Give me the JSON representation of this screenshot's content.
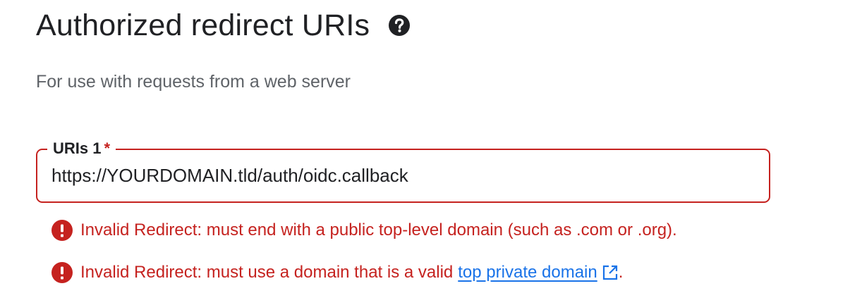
{
  "header": {
    "title": "Authorized redirect URIs",
    "help_icon": "help-circle-icon"
  },
  "subtitle": "For use with requests from a web server",
  "uri_field": {
    "label": "URIs 1",
    "required_marker": "*",
    "value": "https://YOURDOMAIN.tld/auth/oidc.callback"
  },
  "errors": [
    {
      "icon": "error-icon",
      "text": "Invalid Redirect: must end with a public top-level domain (such as .com or .org)."
    },
    {
      "icon": "error-icon",
      "text_before": "Invalid Redirect: must use a domain that is a valid",
      "link_text": "top private domain",
      "link_icon": "open-in-new-icon",
      "text_after": "."
    }
  ],
  "colors": {
    "error": "#c5221f",
    "link": "#1a73e8",
    "text": "#202124",
    "secondary_text": "#5f6368"
  }
}
